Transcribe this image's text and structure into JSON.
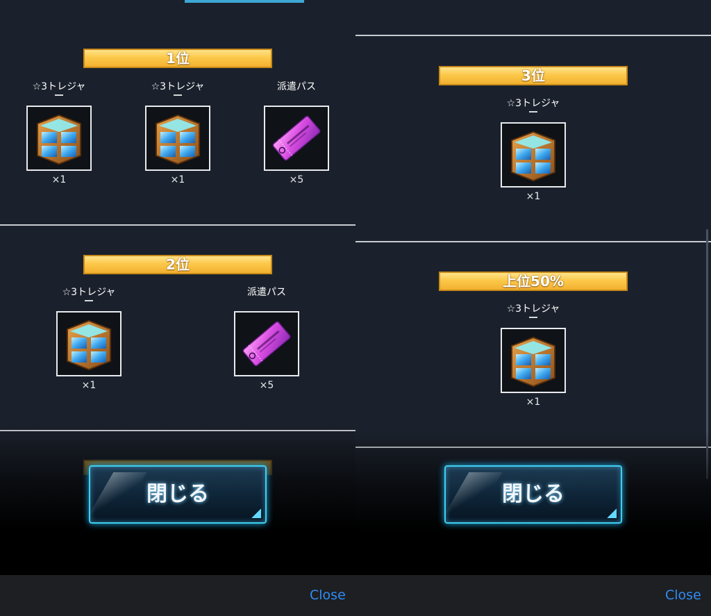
{
  "close_button_label": "閉じる",
  "bottom_close_label": "Close",
  "left_panel": {
    "sections": [
      {
        "rank": "1位",
        "items": [
          {
            "name": "☆3トレジャ",
            "qty": "×1",
            "icon": "treasure-chest-icon"
          },
          {
            "name": "☆3トレジャ",
            "qty": "×1",
            "icon": "treasure-chest-icon"
          },
          {
            "name": "派遣パス",
            "qty": "×5",
            "icon": "dispatch-pass-ticket-icon"
          }
        ]
      },
      {
        "rank": "2位",
        "items": [
          {
            "name": "☆3トレジャ",
            "qty": "×1",
            "icon": "treasure-chest-icon"
          },
          {
            "name": "派遣パス",
            "qty": "×5",
            "icon": "dispatch-pass-ticket-icon"
          }
        ]
      }
    ]
  },
  "right_panel": {
    "sections": [
      {
        "rank": "3位",
        "items": [
          {
            "name": "☆3トレジャ",
            "qty": "×1",
            "icon": "treasure-chest-icon"
          }
        ]
      },
      {
        "rank": "上位50%",
        "items": [
          {
            "name": "☆3トレジャ",
            "qty": "×1",
            "icon": "treasure-chest-icon"
          }
        ]
      }
    ]
  },
  "colors": {
    "background": "#1b212c",
    "banner_gold": "#fcc84a",
    "close_button_glow": "#3ed0f0",
    "link_blue": "#2f8df5"
  }
}
